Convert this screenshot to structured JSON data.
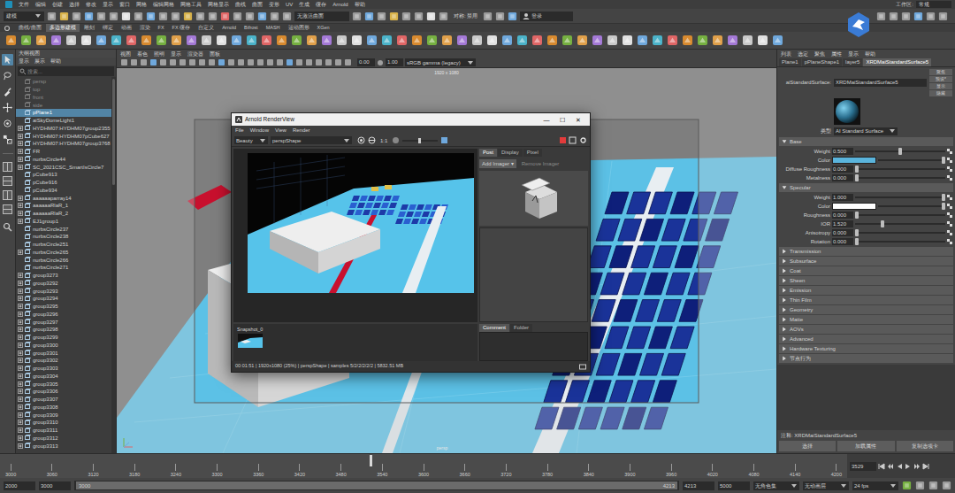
{
  "menubar": {
    "items": [
      "文件",
      "编辑",
      "创建",
      "选择",
      "修改",
      "显示",
      "窗口",
      "网格",
      "编辑网格",
      "网格工具",
      "网格显示",
      "曲线",
      "曲面",
      "变形",
      "UV",
      "生成",
      "缓存",
      "Arnold",
      "帮助"
    ],
    "workspace_label": "工作区:",
    "workspace": "常规"
  },
  "statusline": {
    "mode": "建模",
    "object_field": "无激活曲面",
    "symmetry": "对称: 禁用",
    "login": "登录"
  },
  "shelf": {
    "tabs": [
      {
        "label": "曲线/曲面",
        "selected": false
      },
      {
        "label": "多边形建模",
        "selected": true
      },
      {
        "label": "雕刻",
        "selected": false
      },
      {
        "label": "绑定",
        "selected": false
      },
      {
        "label": "动画",
        "selected": false
      },
      {
        "label": "渲染",
        "selected": false
      },
      {
        "label": "FX",
        "selected": false
      },
      {
        "label": "FX 缓存",
        "selected": false
      },
      {
        "label": "自定义",
        "selected": false
      },
      {
        "label": "Arnold",
        "selected": false
      },
      {
        "label": "Bifrost",
        "selected": false
      },
      {
        "label": "MASH",
        "selected": false
      },
      {
        "label": "运动图形",
        "selected": false
      },
      {
        "label": "XGen",
        "selected": false
      }
    ]
  },
  "toolbox": {
    "tools": [
      {
        "selected": true
      },
      {
        "selected": false
      },
      {
        "selected": false
      },
      {
        "selected": false
      },
      {
        "selected": false
      },
      {
        "selected": false
      }
    ]
  },
  "outliner": {
    "title": "大纲视图",
    "menu": [
      "显示",
      "展示",
      "帮助"
    ],
    "search": "搜索...",
    "items": [
      {
        "label": "persp",
        "selected": false,
        "expandable": false,
        "dimmed": true
      },
      {
        "label": "top",
        "selected": false,
        "expandable": false,
        "dimmed": true
      },
      {
        "label": "front",
        "selected": false,
        "expandable": false,
        "dimmed": true
      },
      {
        "label": "side",
        "selected": false,
        "expandable": false,
        "dimmed": true
      },
      {
        "label": "pPlane1",
        "selected": true,
        "expandable": false,
        "dimmed": false
      },
      {
        "label": "aiSkyDomeLight1",
        "selected": false,
        "expandable": false,
        "dimmed": false
      },
      {
        "label": "HYDHM07:HYDHM07group2355",
        "selected": false,
        "expandable": true,
        "dimmed": false
      },
      {
        "label": "HYDHM07:HYDHM07pCube627",
        "selected": false,
        "expandable": true,
        "dimmed": false
      },
      {
        "label": "HYDHM07:HYDHM07group3768",
        "selected": false,
        "expandable": true,
        "dimmed": false
      },
      {
        "label": "FR",
        "selected": false,
        "expandable": true,
        "dimmed": false
      },
      {
        "label": "nurbsCircle44",
        "selected": false,
        "expandable": true,
        "dimmed": false
      },
      {
        "label": "SC_2021CSC_SmartIsCircle7",
        "selected": false,
        "expandable": true,
        "dimmed": false
      },
      {
        "label": "pCube913",
        "selected": false,
        "expandable": false,
        "dimmed": false
      },
      {
        "label": "pCube916",
        "selected": false,
        "expandable": false,
        "dimmed": false
      },
      {
        "label": "pCube934",
        "selected": false,
        "expandable": false,
        "dimmed": false
      },
      {
        "label": "aaaaaaparray14",
        "selected": false,
        "expandable": true,
        "dimmed": false
      },
      {
        "label": "aaaaaaRlaR_1",
        "selected": false,
        "expandable": true,
        "dimmed": false
      },
      {
        "label": "aaaaaaRlaR_2",
        "selected": false,
        "expandable": true,
        "dimmed": false
      },
      {
        "label": "EJ1group1",
        "selected": false,
        "expandable": true,
        "dimmed": false
      },
      {
        "label": "nurbsCircle237",
        "selected": false,
        "expandable": false,
        "dimmed": false
      },
      {
        "label": "nurbsCircle238",
        "selected": false,
        "expandable": false,
        "dimmed": false
      },
      {
        "label": "nurbsCircle251",
        "selected": false,
        "expandable": false,
        "dimmed": false
      },
      {
        "label": "nurbsCircle265",
        "selected": false,
        "expandable": true,
        "dimmed": false
      },
      {
        "label": "nurbsCircle266",
        "selected": false,
        "expandable": false,
        "dimmed": false
      },
      {
        "label": "nurbsCircle271",
        "selected": false,
        "expandable": false,
        "dimmed": false
      },
      {
        "label": "group3273",
        "selected": false,
        "expandable": true,
        "dimmed": false
      },
      {
        "label": "group3292",
        "selected": false,
        "expandable": true,
        "dimmed": false
      },
      {
        "label": "group3293",
        "selected": false,
        "expandable": true,
        "dimmed": false
      },
      {
        "label": "group3294",
        "selected": false,
        "expandable": true,
        "dimmed": false
      },
      {
        "label": "group3295",
        "selected": false,
        "expandable": true,
        "dimmed": false
      },
      {
        "label": "group3296",
        "selected": false,
        "expandable": true,
        "dimmed": false
      },
      {
        "label": "group3297",
        "selected": false,
        "expandable": true,
        "dimmed": false
      },
      {
        "label": "group3298",
        "selected": false,
        "expandable": true,
        "dimmed": false
      },
      {
        "label": "group3299",
        "selected": false,
        "expandable": true,
        "dimmed": false
      },
      {
        "label": "group3300",
        "selected": false,
        "expandable": true,
        "dimmed": false
      },
      {
        "label": "group3301",
        "selected": false,
        "expandable": true,
        "dimmed": false
      },
      {
        "label": "group3302",
        "selected": false,
        "expandable": true,
        "dimmed": false
      },
      {
        "label": "group3303",
        "selected": false,
        "expandable": true,
        "dimmed": false
      },
      {
        "label": "group3304",
        "selected": false,
        "expandable": true,
        "dimmed": false
      },
      {
        "label": "group3305",
        "selected": false,
        "expandable": true,
        "dimmed": false
      },
      {
        "label": "group3306",
        "selected": false,
        "expandable": true,
        "dimmed": false
      },
      {
        "label": "group3307",
        "selected": false,
        "expandable": true,
        "dimmed": false
      },
      {
        "label": "group3308",
        "selected": false,
        "expandable": true,
        "dimmed": false
      },
      {
        "label": "group3309",
        "selected": false,
        "expandable": true,
        "dimmed": false
      },
      {
        "label": "group3310",
        "selected": false,
        "expandable": true,
        "dimmed": false
      },
      {
        "label": "group3311",
        "selected": false,
        "expandable": true,
        "dimmed": false
      },
      {
        "label": "group3312",
        "selected": false,
        "expandable": true,
        "dimmed": false
      },
      {
        "label": "group3313",
        "selected": false,
        "expandable": true,
        "dimmed": false
      }
    ]
  },
  "viewport": {
    "menu": [
      "视图",
      "着色",
      "照明",
      "显示",
      "渲染器",
      "面板"
    ],
    "exposure": "0.00",
    "gamma": "1.00",
    "color_space": "sRGB gamma (legacy)",
    "resolution": "1920 x 1080",
    "camera": "persp"
  },
  "render_view": {
    "title": "Arnold RenderView",
    "controls": [
      "—",
      "☐",
      "✕"
    ],
    "menu": [
      "File",
      "Window",
      "View",
      "Render"
    ],
    "aov": "Beauty",
    "camera": "perspShape",
    "zoom": "1:1",
    "rendering": true,
    "side_tabs": [
      {
        "label": "Post",
        "selected": true
      },
      {
        "label": "Display",
        "selected": false
      },
      {
        "label": "Pixel",
        "selected": false
      }
    ],
    "add_imager": "Add Imager ▾",
    "remove_imager": "Remove Imager",
    "snapshots": [
      {
        "label": "Snapshot_0",
        "selected": false
      }
    ],
    "note_tabs": [
      {
        "label": "Comment",
        "selected": true
      },
      {
        "label": "Folder",
        "selected": false
      }
    ],
    "status": "00:01:51 | 1920x1080 (25%) | perspShape | samples 5/2/2/2/2/2 | 5832.51 MB"
  },
  "attribute_editor": {
    "menu": [
      "列表",
      "选定",
      "聚焦",
      "属性",
      "显示",
      "帮助"
    ],
    "tabs": [
      {
        "label": "Plane1",
        "selected": false
      },
      {
        "label": "pPlaneShape1",
        "selected": false
      },
      {
        "label": "layer5",
        "selected": false
      },
      {
        "label": "XRDMaiStandardSurface5",
        "selected": true
      }
    ],
    "node_label": "aiStandardSurface:",
    "node_name": "XRDMaiStandardSurface5",
    "buttons": [
      "聚焦",
      "预设*",
      "显示",
      "隐藏"
    ],
    "type_label": "类型",
    "type": "AI Standard Surface",
    "sections": [
      {
        "label": "Base",
        "expanded": true,
        "rows": [
          {
            "label": "Weight",
            "kind": "slider",
            "value": "0.500",
            "level": 0.5
          },
          {
            "label": "Color",
            "kind": "color",
            "color": "#5ab4dc",
            "level": 1
          },
          {
            "label": "Diffuse Roughness",
            "kind": "slider",
            "value": "0.000",
            "level": 0
          },
          {
            "label": "Metalness",
            "kind": "slider",
            "value": "0.000",
            "level": 0
          }
        ]
      },
      {
        "label": "Specular",
        "expanded": true,
        "rows": [
          {
            "label": "Weight",
            "kind": "slider",
            "value": "1.000",
            "level": 1
          },
          {
            "label": "Color",
            "kind": "color",
            "color": "#ffffff",
            "level": 1
          },
          {
            "label": "Roughness",
            "kind": "slider",
            "value": "0.000",
            "level": 0
          },
          {
            "label": "IOR",
            "kind": "slider",
            "value": "1.520",
            "level": 0.3
          },
          {
            "label": "Anisotropy",
            "kind": "slider",
            "value": "0.000",
            "level": 0
          },
          {
            "label": "Rotation",
            "kind": "slider",
            "value": "0.000",
            "level": 0
          }
        ]
      },
      {
        "label": "Transmission",
        "expanded": false
      },
      {
        "label": "Subsurface",
        "expanded": false
      },
      {
        "label": "Coat",
        "expanded": false
      },
      {
        "label": "Sheen",
        "expanded": false
      },
      {
        "label": "Emission",
        "expanded": false
      },
      {
        "label": "Thin Film",
        "expanded": false
      },
      {
        "label": "Geometry",
        "expanded": false
      },
      {
        "label": "Matte",
        "expanded": false
      },
      {
        "label": "AOVs",
        "expanded": false
      },
      {
        "label": "Advanced",
        "expanded": false
      },
      {
        "label": "Hardware Texturing",
        "expanded": false
      },
      {
        "label": "节点行为",
        "expanded": false
      }
    ],
    "notes": "注释: XRDMaiStandardSurface5",
    "bottom_buttons": [
      "选择",
      "加载属性",
      "复制选项卡"
    ]
  },
  "timeline": {
    "ticks": [
      "3000",
      "3060",
      "3120",
      "3180",
      "3240",
      "3300",
      "3360",
      "3420",
      "3480",
      "3540",
      "3600",
      "3660",
      "3720",
      "3780",
      "3840",
      "3900",
      "3960",
      "4020",
      "4080",
      "4140",
      "4200"
    ],
    "level": 0.436,
    "current_frame": "3529"
  },
  "range": {
    "start": "2000",
    "inner_start": "3000",
    "bar_start": "3000",
    "bar_end": "4213",
    "inner_end": "4213",
    "end": "5000",
    "character_set": "无角色集",
    "anim_layer": "无动画层",
    "fps": "24 fps"
  }
}
